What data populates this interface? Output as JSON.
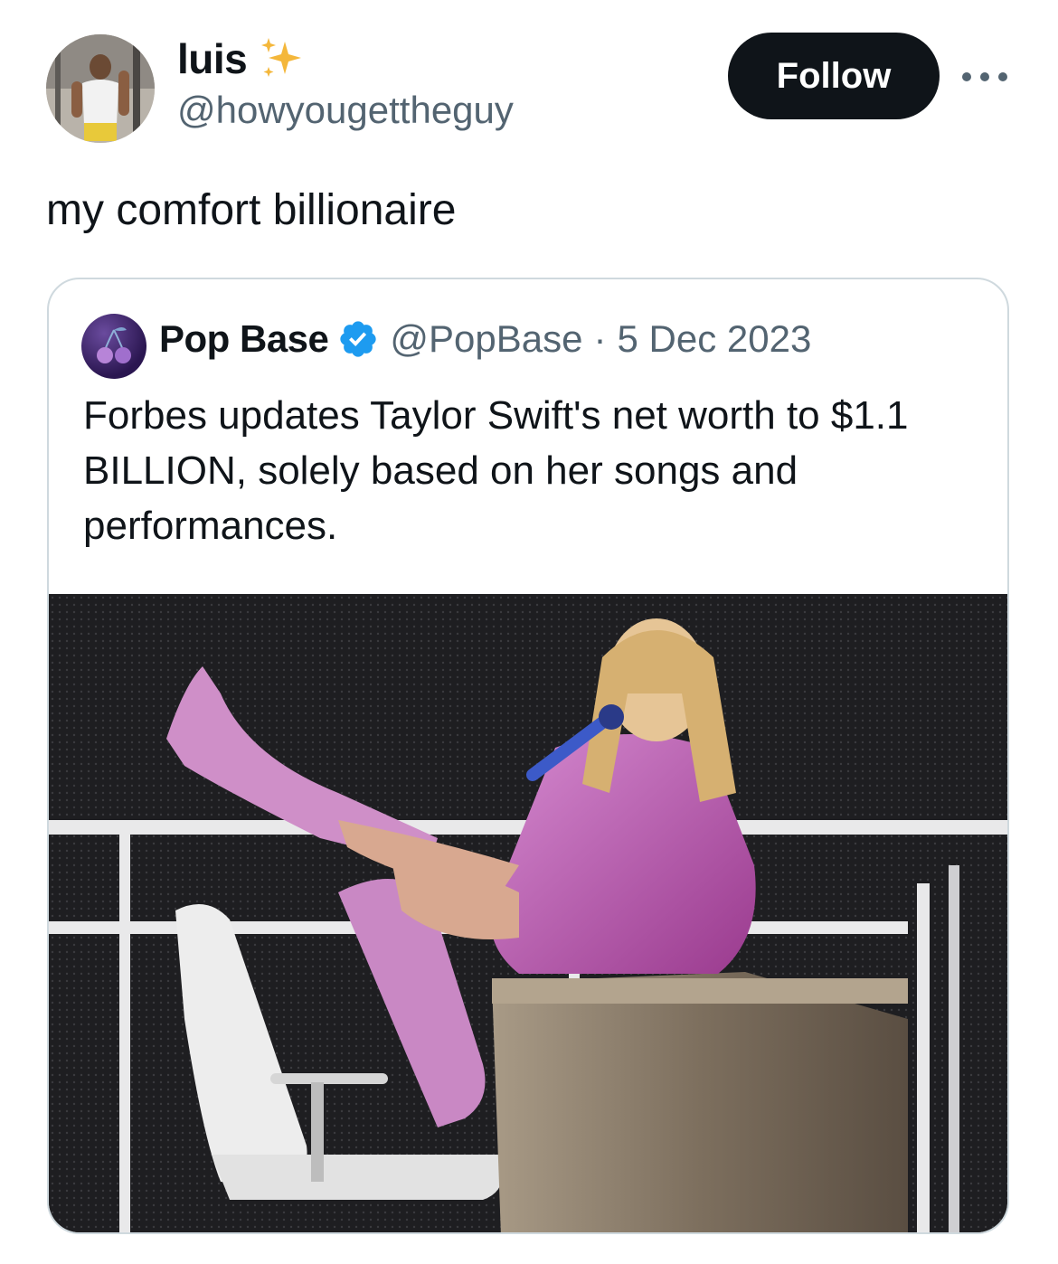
{
  "tweet": {
    "author_name": "luis",
    "author_emoji_icon": "sparkles-icon",
    "author_handle": "@howyougettheguy",
    "follow_label": "Follow",
    "more_icon": "more-options-icon",
    "text": "my comfort billionaire"
  },
  "quoted": {
    "name": "Pop Base",
    "verified_icon": "verified-badge-icon",
    "handle": "@PopBase",
    "separator": "·",
    "date": "5 Dec 2023",
    "text": "Forbes updates Taylor Swift's net worth to $1.1 BILLION, solely based on her songs and performances.",
    "image": "photo of performer in sparkly pink outfit and boots seated on wooden desk on stage"
  },
  "colors": {
    "text_primary": "#0f1419",
    "text_secondary": "#536471",
    "follow_bg": "#0f1419",
    "border": "#cfd9de",
    "verified": "#1d9bf0",
    "sparkle": "#f4b73b"
  }
}
